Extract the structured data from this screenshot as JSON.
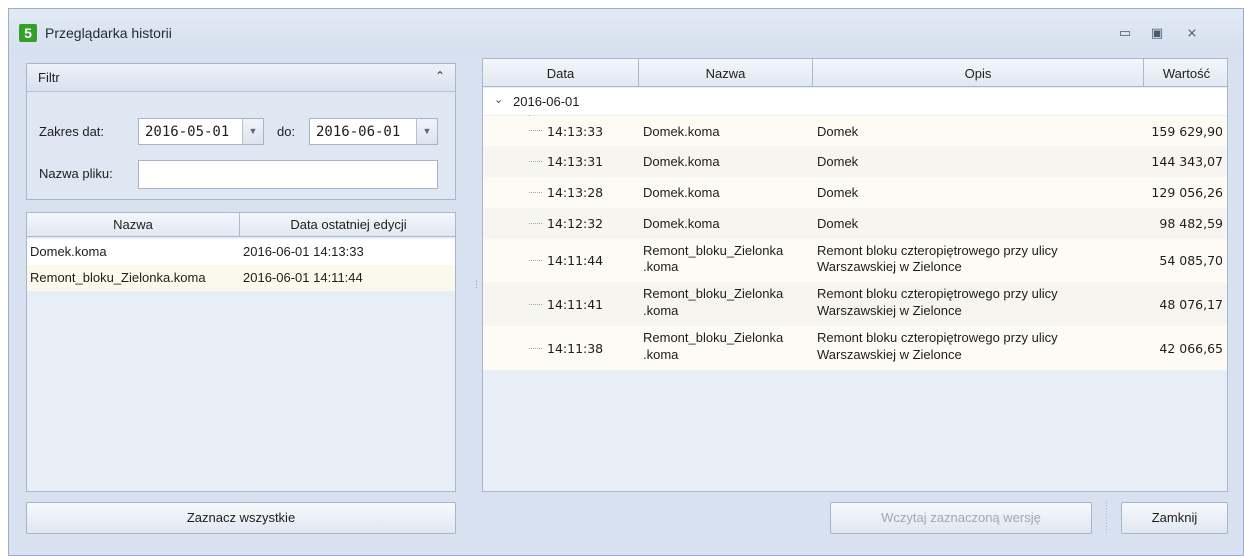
{
  "window": {
    "title": "Przeglądarka historii",
    "app_icon": "5",
    "min_glyph": "▭",
    "max_glyph": "▣",
    "close_glyph": "⨯"
  },
  "filter": {
    "header": "Filtr",
    "collapse_glyph": "⌃",
    "date_range_label": "Zakres dat:",
    "date_from": "2016-05-01",
    "to_label": "do:",
    "date_to": "2016-06-01",
    "dropdown_glyph": "▼",
    "file_name_label": "Nazwa pliku:",
    "file_name_value": ""
  },
  "files": {
    "columns": [
      "Nazwa",
      "Data ostatniej edycji"
    ],
    "rows": [
      {
        "name": "Domek.koma",
        "date": "2016-06-01 14:13:33"
      },
      {
        "name": "Remont_bloku_Zielonka.koma",
        "date": "2016-06-01 14:11:44"
      }
    ]
  },
  "history": {
    "columns": [
      "Data",
      "Nazwa",
      "Opis",
      "Wartość"
    ],
    "group": "2016-06-01",
    "group_glyph": "⌄",
    "rows": [
      {
        "time": "14:13:33",
        "name": "Domek.koma",
        "desc": "Domek",
        "value": "159 629,90"
      },
      {
        "time": "14:13:31",
        "name": "Domek.koma",
        "desc": "Domek",
        "value": "144 343,07"
      },
      {
        "time": "14:13:28",
        "name": "Domek.koma",
        "desc": "Domek",
        "value": "129 056,26"
      },
      {
        "time": "14:12:32",
        "name": "Domek.koma",
        "desc": "Domek",
        "value": "98 482,59"
      },
      {
        "time": "14:11:44",
        "name1": "Remont_bloku_Zielonka",
        "name2": ".koma",
        "desc1": "Remont bloku czteropiętrowego przy ulicy",
        "desc2": "Warszawskiej w Zielonce",
        "value": "54 085,70"
      },
      {
        "time": "14:11:41",
        "name1": "Remont_bloku_Zielonka",
        "name2": ".koma",
        "desc1": "Remont bloku czteropiętrowego przy ulicy",
        "desc2": "Warszawskiej w Zielonce",
        "value": "48 076,17"
      },
      {
        "time": "14:11:38",
        "name1": "Remont_bloku_Zielonka",
        "name2": ".koma",
        "desc1": "Remont bloku czteropiętrowego przy ulicy",
        "desc2": "Warszawskiej w Zielonce",
        "value": "42 066,65"
      }
    ]
  },
  "buttons": {
    "select_all": "Zaznacz wszystkie",
    "load_selected": "Wczytaj zaznaczoną wersję",
    "close": "Zamknij"
  },
  "splitter_glyph": "⋮"
}
